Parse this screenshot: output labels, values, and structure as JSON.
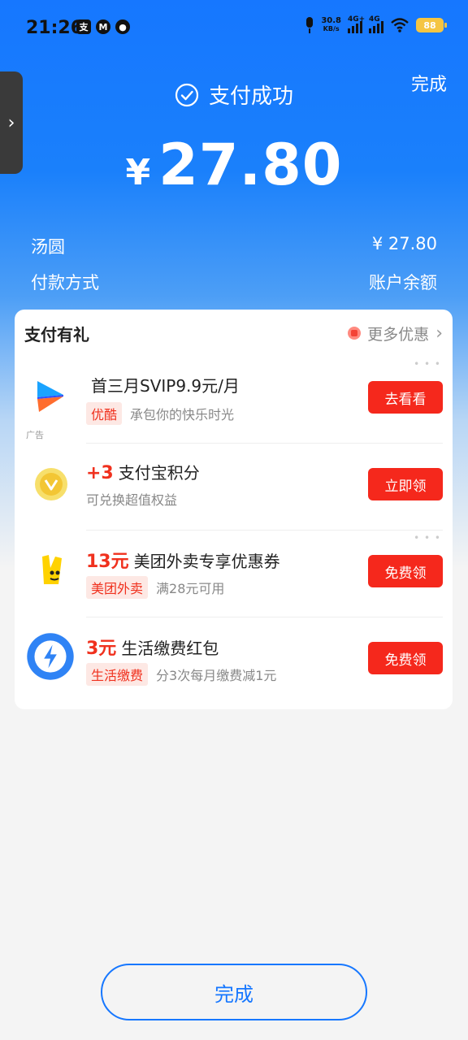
{
  "status_bar": {
    "time": "21:26",
    "left_icons": [
      "alipay-icon",
      "m-icon",
      "wechat-icon"
    ],
    "net_speed_value": "30.8",
    "net_speed_unit": "KB/s",
    "signal1_label": "4G+",
    "signal2_label": "4G",
    "battery": "88"
  },
  "header": {
    "done_label": "完成",
    "success_text": "支付成功",
    "currency": "¥",
    "amount": "27.80"
  },
  "details": {
    "item_name": "汤圆",
    "item_amount": "¥ 27.80",
    "method_label": "付款方式",
    "method_value": "账户余额"
  },
  "gift_card": {
    "title": "支付有礼",
    "more_label": "更多优惠",
    "offers": [
      {
        "highlight": "",
        "title": "首三月SVIP9.9元/月",
        "tag": "优酷",
        "desc": "承包你的快乐时光",
        "button": "去看看",
        "ad_label": "广告",
        "icon": "youku-icon"
      },
      {
        "highlight": "+3",
        "title": "支付宝积分",
        "tag": "",
        "desc": "可兑换超值权益",
        "button": "立即领",
        "icon": "points-coin-icon"
      },
      {
        "highlight": "13元",
        "title": "美团外卖专享优惠券",
        "tag": "美团外卖",
        "desc": "满28元可用",
        "button": "免费领",
        "icon": "meituan-icon"
      },
      {
        "highlight": "3元",
        "title": "生活缴费红包",
        "tag": "生活缴费",
        "desc": "分3次每月缴费减1元",
        "button": "免费领",
        "icon": "utility-bolt-icon"
      }
    ]
  },
  "footer": {
    "done_label": "完成"
  },
  "colors": {
    "primary": "#1677ff",
    "accent_red": "#f5281c",
    "tag_bg": "#fde8e4"
  }
}
